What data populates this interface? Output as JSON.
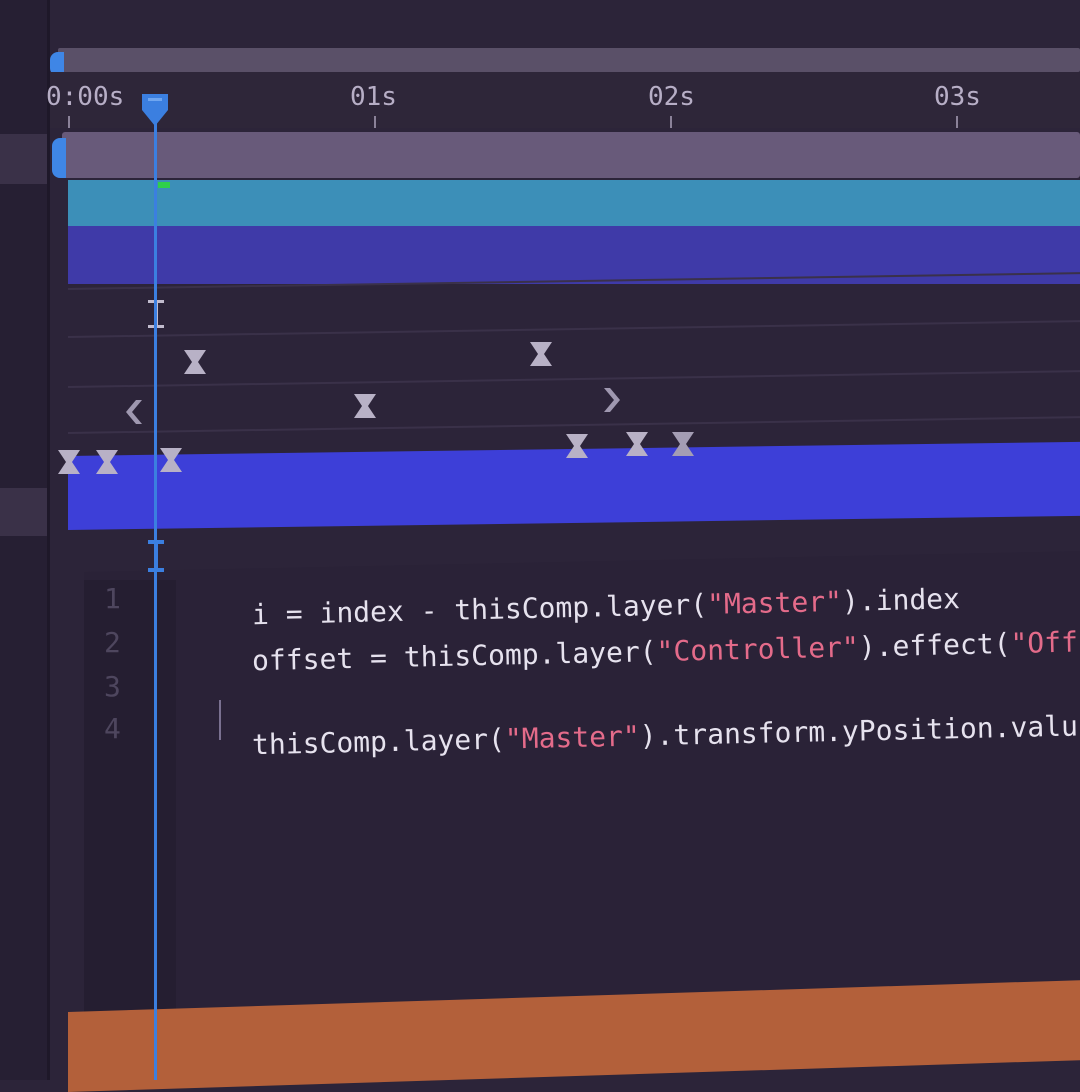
{
  "ruler": {
    "labels": [
      "0:00s",
      "01s",
      "02s",
      "03s"
    ]
  },
  "colors": {
    "playhead": "#3b7fe0",
    "layer_teal": "#3c8fb8",
    "layer_indigo": "#3f3aa8",
    "layer_blue": "#3d3fd8",
    "layer_orange": "#b3603a",
    "string": "#e46b8a"
  },
  "keyframe_icons": [
    "hourglass-keyframe-icon",
    "ease-in-keyframe-icon",
    "ease-out-keyframe-icon",
    "hold-keyframe-icon"
  ],
  "editor": {
    "line_numbers": [
      "1",
      "2",
      "3",
      "4"
    ],
    "lines": [
      {
        "pre": "i = index - thisComp.layer(",
        "str": "\"Master\"",
        "post": ").index"
      },
      {
        "pre": "offset = thisComp.layer(",
        "str": "\"Controller\"",
        "post": ").effect(",
        "str2": "\"Off"
      },
      {
        "pre": "",
        "str": "",
        "post": ""
      },
      {
        "pre": "thisComp.layer(",
        "str": "\"Master\"",
        "post": ").transform.yPosition.valu"
      }
    ]
  }
}
